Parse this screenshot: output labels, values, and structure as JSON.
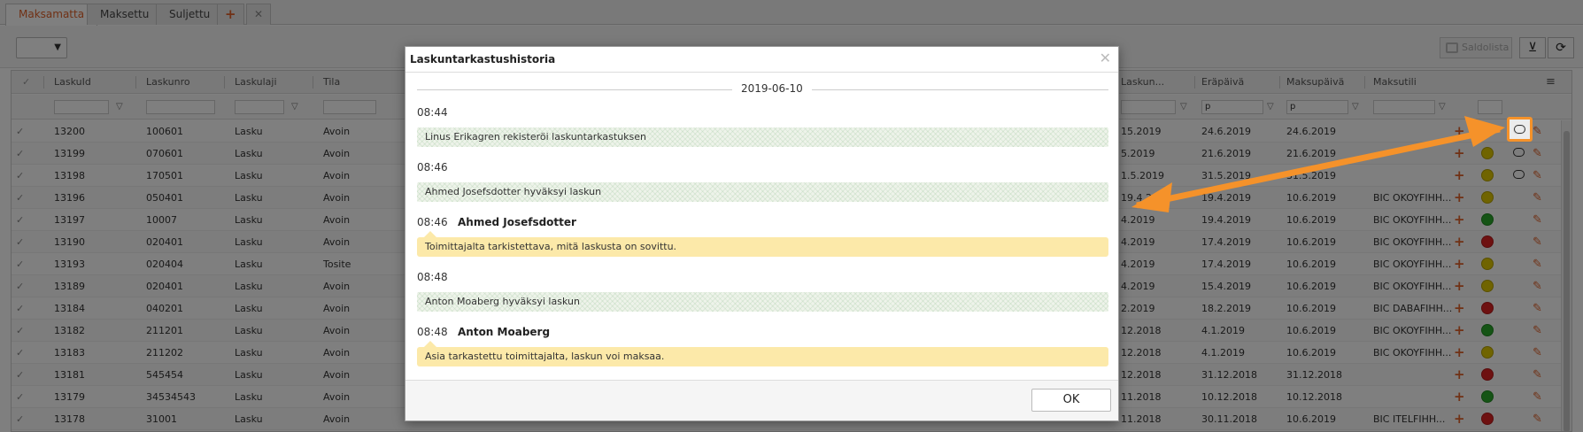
{
  "tabs": [
    {
      "label": "Maksamatta",
      "active": true
    },
    {
      "label": "Maksettu",
      "active": false
    },
    {
      "label": "Suljettu",
      "active": false
    }
  ],
  "tab_add_icon": "+",
  "tab_close_icon": "✕",
  "toolbar": {
    "saldo_label": "Saldolista",
    "clear_filter_icon": "filter-clear-icon",
    "refresh_icon": "refresh-icon"
  },
  "grid": {
    "headers": [
      "LaskuId",
      "Laskunro",
      "Laskulaji",
      "Tila",
      "Laskun...",
      "Eräpäivä",
      "Maksupäivä",
      "Maksutili"
    ],
    "filter_values": [
      "p",
      "p"
    ],
    "rows": [
      {
        "id": "13200",
        "nro": "100601",
        "laji": "Lasku",
        "tila": "Avoin",
        "pvm": "15.2019",
        "era": "24.6.2019",
        "maksu": "24.6.2019",
        "tili": "",
        "status": "#e0c800",
        "comment": true
      },
      {
        "id": "13199",
        "nro": "070601",
        "laji": "Lasku",
        "tila": "Avoin",
        "pvm": "5.2019",
        "era": "21.6.2019",
        "maksu": "21.6.2019",
        "tili": "",
        "status": "#e0c800",
        "comment": true
      },
      {
        "id": "13198",
        "nro": "170501",
        "laji": "Lasku",
        "tila": "Avoin",
        "pvm": "1.5.2019",
        "era": "31.5.2019",
        "maksu": "31.5.2019",
        "tili": "",
        "status": "#e0c800",
        "comment": true
      },
      {
        "id": "13196",
        "nro": "050401",
        "laji": "Lasku",
        "tila": "Avoin",
        "pvm": "19.4.2019",
        "era": "19.4.2019",
        "maksu": "10.6.2019",
        "tili": "BIC OKOYFIHH...",
        "status": "#e0c800",
        "comment": false
      },
      {
        "id": "13197",
        "nro": "10007",
        "laji": "Lasku",
        "tila": "Avoin",
        "pvm": "4.2019",
        "era": "19.4.2019",
        "maksu": "10.6.2019",
        "tili": "BIC OKOYFIHH...",
        "status": "#2aa82a",
        "comment": false
      },
      {
        "id": "13190",
        "nro": "020401",
        "laji": "Lasku",
        "tila": "Avoin",
        "pvm": "4.2019",
        "era": "17.4.2019",
        "maksu": "10.6.2019",
        "tili": "BIC OKOYFIHH...",
        "status": "#dd2222",
        "comment": false
      },
      {
        "id": "13193",
        "nro": "020404",
        "laji": "Lasku",
        "tila": "Tosite",
        "pvm": "4.2019",
        "era": "17.4.2019",
        "maksu": "10.6.2019",
        "tili": "BIC OKOYFIHH...",
        "status": "#e0c800",
        "comment": false
      },
      {
        "id": "13189",
        "nro": "020401",
        "laji": "Lasku",
        "tila": "Avoin",
        "pvm": "4.2019",
        "era": "15.4.2019",
        "maksu": "10.6.2019",
        "tili": "BIC OKOYFIHH...",
        "status": "#e0c800",
        "comment": false
      },
      {
        "id": "13184",
        "nro": "040201",
        "laji": "Lasku",
        "tila": "Avoin",
        "pvm": "2.2019",
        "era": "18.2.2019",
        "maksu": "10.6.2019",
        "tili": "BIC DABAFIHH...",
        "status": "#dd2222",
        "comment": false
      },
      {
        "id": "13182",
        "nro": "211201",
        "laji": "Lasku",
        "tila": "Avoin",
        "pvm": "12.2018",
        "era": "4.1.2019",
        "maksu": "10.6.2019",
        "tili": "BIC OKOYFIHH...",
        "status": "#2aa82a",
        "comment": false
      },
      {
        "id": "13183",
        "nro": "211202",
        "laji": "Lasku",
        "tila": "Avoin",
        "pvm": "12.2018",
        "era": "4.1.2019",
        "maksu": "10.6.2019",
        "tili": "BIC OKOYFIHH...",
        "status": "#e0c800",
        "comment": false
      },
      {
        "id": "13181",
        "nro": "545454",
        "laji": "Lasku",
        "tila": "Avoin",
        "pvm": "12.2018",
        "era": "31.12.2018",
        "maksu": "31.12.2018",
        "tili": "",
        "status": "#dd2222",
        "comment": false
      },
      {
        "id": "13179",
        "nro": "34534543",
        "laji": "Lasku",
        "tila": "Avoin",
        "pvm": "11.2018",
        "era": "10.12.2018",
        "maksu": "10.12.2018",
        "tili": "",
        "status": "#2aa82a",
        "comment": false
      },
      {
        "id": "13178",
        "nro": "31001",
        "laji": "Lasku",
        "tila": "Avoin",
        "pvm": "11.2018",
        "era": "30.11.2018",
        "maksu": "10.6.2019",
        "tili": "BIC ITELFIHH...",
        "status": "#dd2222",
        "comment": false
      }
    ]
  },
  "modal": {
    "title": "Laskuntarkastushistoria",
    "date": "2019-06-10",
    "entries": [
      {
        "time": "08:44",
        "type": "system",
        "text": "Linus Erikagren rekisteröi laskuntarkastuksen"
      },
      {
        "time": "08:46",
        "type": "system",
        "text": "Ahmed Josefsdotter hyväksyi laskun"
      },
      {
        "time": "08:46",
        "type": "comment",
        "author": "Ahmed Josefsdotter",
        "text": "Toimittajalta tarkistettava, mitä laskusta on sovittu."
      },
      {
        "time": "08:48",
        "type": "system",
        "text": "Anton Moaberg hyväksyi laskun"
      },
      {
        "time": "08:48",
        "type": "comment",
        "author": "Anton Moaberg",
        "text": "Asia tarkastettu toimittajalta, laskun voi maksaa."
      }
    ],
    "ok_label": "OK"
  },
  "colors": {
    "accent": "#e0622b",
    "annotation": "#f5922a",
    "note_bg": "#fce9a9"
  }
}
